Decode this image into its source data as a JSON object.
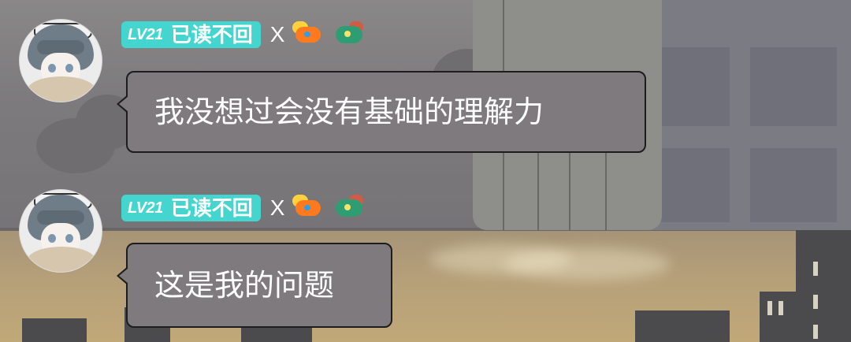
{
  "colors": {
    "badge_bg": "#45d5cf",
    "bubble_bg": "#7e7a7d",
    "bubble_border": "#1d1d1d",
    "text": "#ffffff"
  },
  "messages": [
    {
      "badge": {
        "level": "LV21",
        "status": "已读不回"
      },
      "separator": "X",
      "icons": [
        "red-dragon-medal-icon",
        "green-dragon-medal-icon"
      ],
      "text": "我没想过会没有基础的理解力"
    },
    {
      "badge": {
        "level": "LV21",
        "status": "已读不回"
      },
      "separator": "X",
      "icons": [
        "red-dragon-medal-icon",
        "green-dragon-medal-icon"
      ],
      "text": "这是我的问题"
    }
  ]
}
